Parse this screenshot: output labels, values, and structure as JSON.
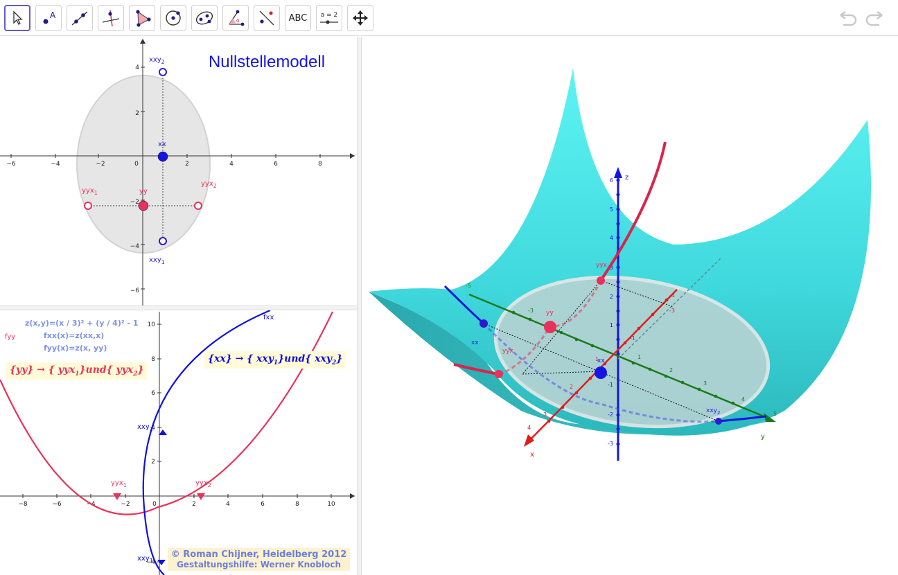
{
  "toolbar": {
    "tools": [
      {
        "name": "move-tool",
        "label": ""
      },
      {
        "name": "point-tool",
        "label": ""
      },
      {
        "name": "line-tool",
        "label": ""
      },
      {
        "name": "perpendicular-line-tool",
        "label": ""
      },
      {
        "name": "polygon-tool",
        "label": ""
      },
      {
        "name": "circle-tool",
        "label": ""
      },
      {
        "name": "ellipse-tool",
        "label": ""
      },
      {
        "name": "angle-tool",
        "label": ""
      },
      {
        "name": "reflect-tool",
        "label": ""
      },
      {
        "name": "text-tool",
        "label": "ABC"
      },
      {
        "name": "slider-tool",
        "label": "a = 2"
      },
      {
        "name": "move-view-tool",
        "label": ""
      }
    ],
    "undo_icon": "undo-icon",
    "redo_icon": "redo-icon"
  },
  "graphics1": {
    "title": "Nullstellemodell",
    "x_ticks": [
      "−6",
      "−4",
      "−2",
      "0",
      "2",
      "4",
      "6",
      "8"
    ],
    "y_ticks": [
      "4",
      "2",
      "−2",
      "−4",
      "−6"
    ],
    "points": {
      "xxy2": "xxy",
      "xxy2_sub": "2",
      "xx": "xx",
      "yyx1": "yyx",
      "yyx1_sub": "1",
      "yy": "yy",
      "yyx2": "yyx",
      "yyx2_sub": "2",
      "xxy1": "xxy",
      "xxy1_sub": "1"
    }
  },
  "graphics2": {
    "functions": {
      "z": "z(x,y)=(x / 3)² + (y / 4)² - 1",
      "fxx": "fxx(x)=z(xx,x)",
      "fyy": "fyy(x)=z(x, yy)"
    },
    "curve_labels": {
      "fxx": "fxx",
      "fyy": "fyy"
    },
    "text_yy": "{yy} → { yyx",
    "text_yy_sub1": "1",
    "text_yy_mid": "}und{ yyx",
    "text_yy_sub2": "2",
    "text_yy_end": "}",
    "text_xx": "{xx} → { xxy",
    "text_xx_sub1": "1",
    "text_xx_mid": "}und{ xxy",
    "text_xx_sub2": "2",
    "text_xx_end": "}",
    "x_ticks": [
      "−8",
      "−6",
      "−4",
      "−2",
      "0",
      "2",
      "4",
      "6",
      "8",
      "10"
    ],
    "y_ticks": [
      "10",
      "8",
      "6",
      "4",
      "2",
      "−4"
    ],
    "points": {
      "xxy2": "xxy",
      "xxy2_sub": "2",
      "xxy1": "xxy",
      "xxy1_sub": "1",
      "yyx1": "yyx",
      "yyx1_sub": "1",
      "yyx2": "yyx",
      "yyx2_sub": "2"
    },
    "credit_line1": "© Roman Chijner, Heidelberg 2012",
    "credit_line2": "Gestaltungshilfe: Werner Knobloch"
  },
  "graphics3d": {
    "axis_labels": {
      "x": "x",
      "y": "y",
      "z": "z"
    },
    "z_ticks": [
      "6",
      "5",
      "4",
      "3",
      "2",
      "1",
      "-1",
      "-2",
      "-3"
    ],
    "x_ticks": [
      "-1",
      "1",
      "2",
      "3",
      "4",
      "-3",
      "-4"
    ],
    "y_ticks": [
      "1",
      "2",
      "3",
      "4",
      "5",
      "-3",
      "-5"
    ],
    "points": {
      "yy": "yy",
      "xx": "xx",
      "yyx": "yyx",
      "xx_left": "xx",
      "yyx_left": "yyx",
      "xxy2": "xxy",
      "xxy2_sub": "2"
    }
  },
  "colors": {
    "blue": "#1010e0",
    "red": "#e8325a",
    "green": "#1a7a1a",
    "surface": "#3fe0e4",
    "ellipse": "#e8e8e8",
    "accent": "#6557d2"
  }
}
